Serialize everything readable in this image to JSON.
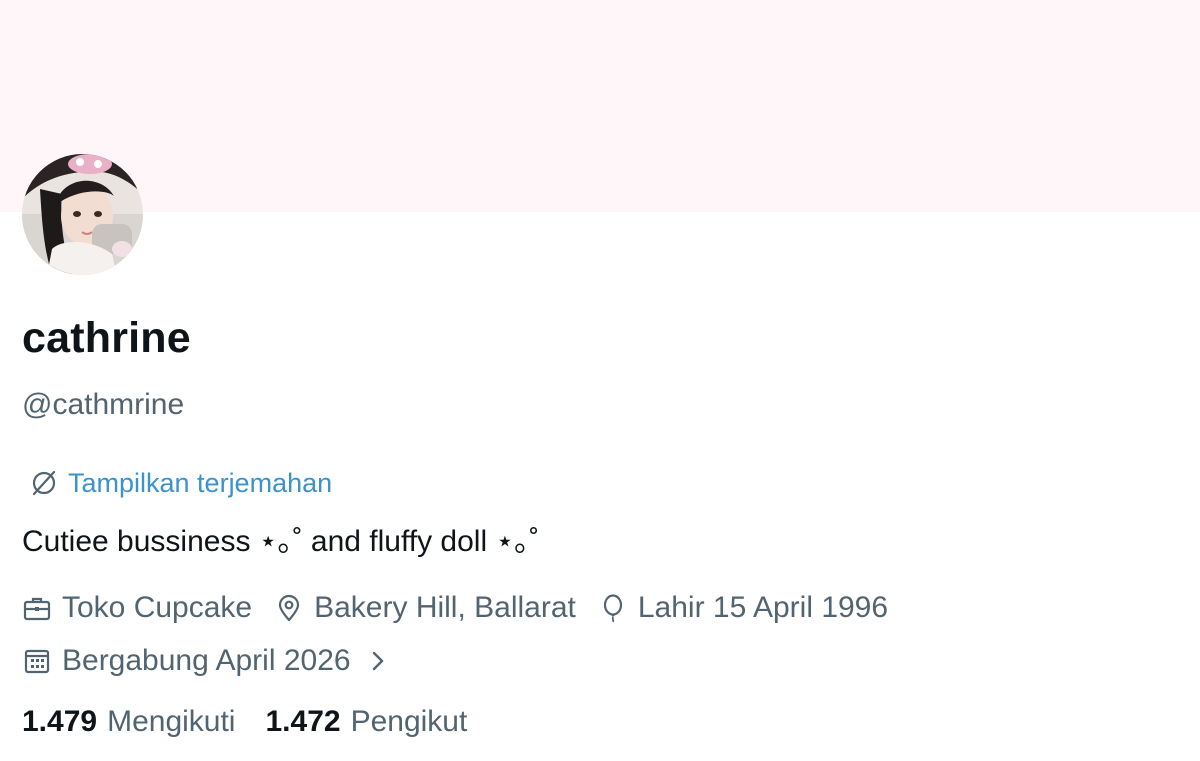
{
  "profile": {
    "display_name": "cathrine",
    "handle": "@cathmrine",
    "translate_label": "Tampilkan terjemahan",
    "bio": "Cutiee bussiness ⋆｡˚ and fluffy doll ⋆｡˚"
  },
  "meta": {
    "work": "Toko Cupcake",
    "location": "Bakery Hill, Ballarat",
    "birthday": "Lahir 15 April 1996",
    "joined": "Bergabung April 2026"
  },
  "stats": {
    "following_count": "1.479",
    "following_label": "Mengikuti",
    "followers_count": "1.472",
    "followers_label": "Pengikut"
  },
  "colors": {
    "banner": "#fff6fa",
    "link": "#3a93cc",
    "secondary_text": "#536471",
    "primary_text": "#0f1419"
  },
  "icons": [
    "translate-icon",
    "briefcase-icon",
    "location-pin-icon",
    "balloon-icon",
    "calendar-icon",
    "chevron-right-icon"
  ]
}
